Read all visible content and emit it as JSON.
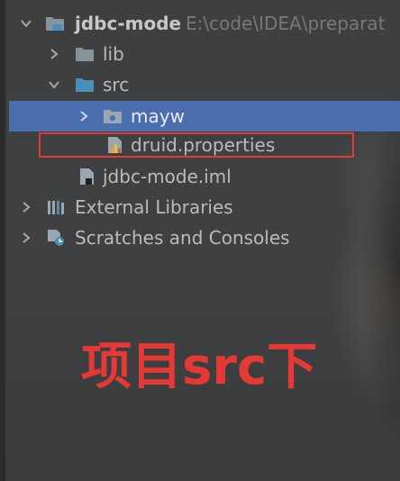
{
  "project_tree": {
    "root": {
      "name": "jdbc-mode",
      "path": "E:\\code\\IDEA\\preparat"
    },
    "items": [
      {
        "label": "lib"
      },
      {
        "label": "src"
      },
      {
        "label": "mayw"
      },
      {
        "label": "druid.properties"
      },
      {
        "label": "jdbc-mode.iml"
      },
      {
        "label": "External Libraries"
      },
      {
        "label": "Scratches and Consoles"
      }
    ]
  },
  "annotation": {
    "text": "项目src下"
  },
  "colors": {
    "background": "#3c3f41",
    "selection": "#4b6eaf",
    "folder": "#87939a",
    "source_folder": "#4a8fb5",
    "highlight": "#e53935"
  },
  "icons": {
    "root": "module-folder-icon",
    "lib": "folder-icon",
    "src": "source-folder-icon",
    "mayw": "package-folder-icon",
    "druid": "properties-file-icon",
    "iml": "iml-file-icon",
    "libraries": "libraries-icon",
    "scratches": "scratches-icon"
  }
}
